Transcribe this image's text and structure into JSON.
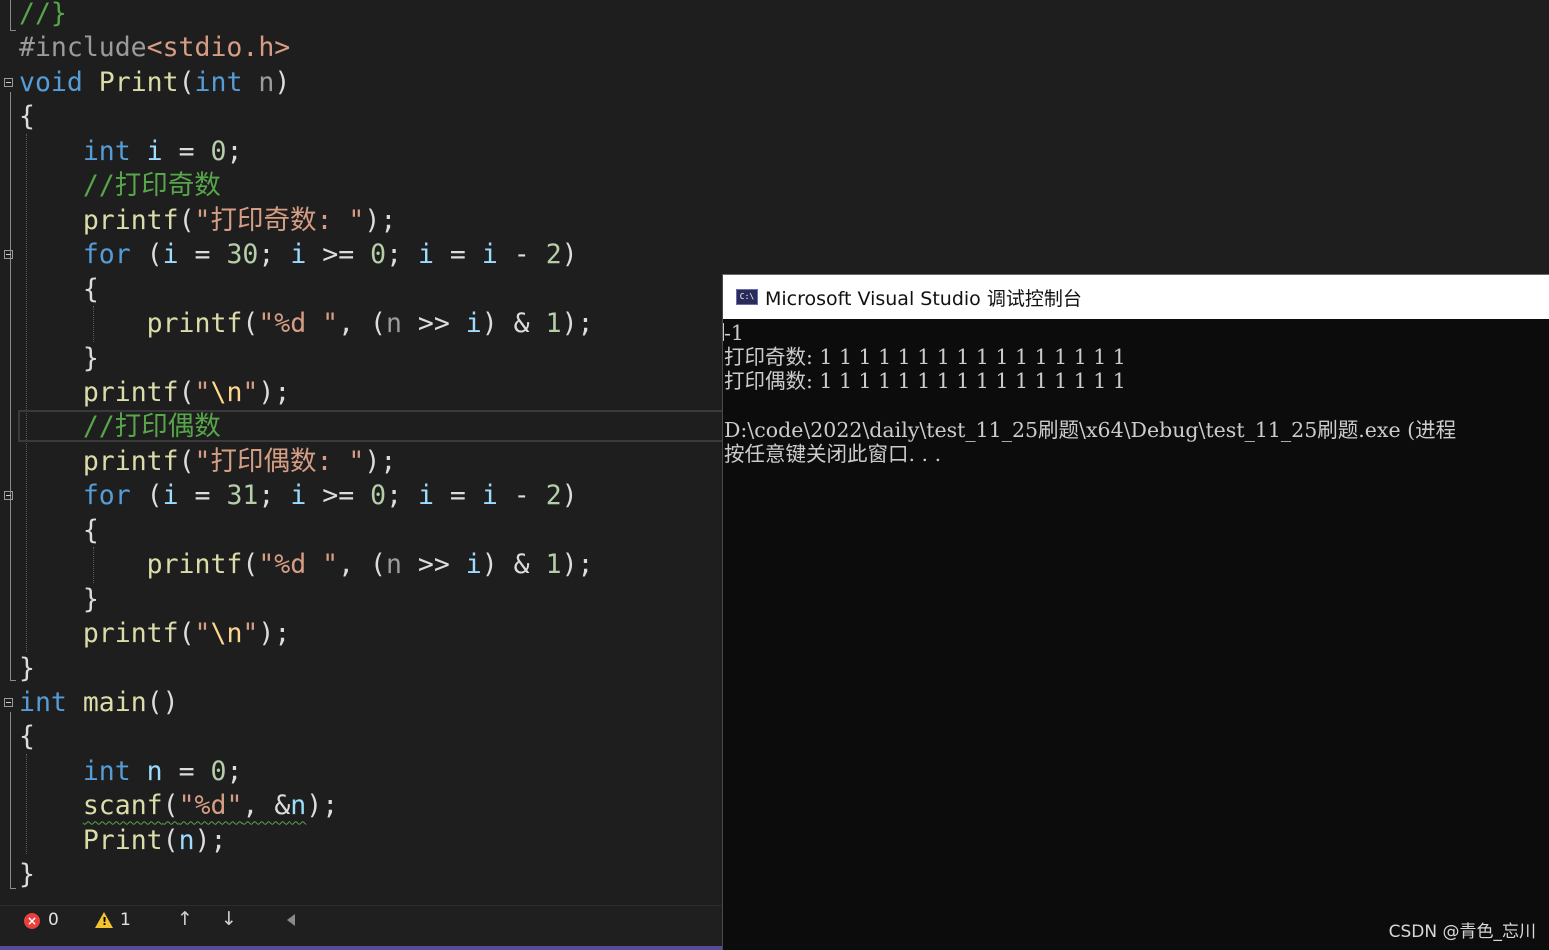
{
  "editor": {
    "lines": [
      [
        [
          "c",
          "//}"
        ]
      ],
      [
        [
          "p",
          "#include"
        ],
        [
          "s",
          "<stdio.h>"
        ]
      ],
      [
        [
          "k",
          "void"
        ],
        [
          "m",
          " "
        ],
        [
          "f",
          "Print"
        ],
        [
          "m",
          "("
        ],
        [
          "k",
          "int"
        ],
        [
          "m",
          " "
        ],
        [
          "p",
          "n"
        ],
        [
          "m",
          ")"
        ]
      ],
      [
        [
          "m",
          "{"
        ]
      ],
      [
        [
          "m",
          "    "
        ],
        [
          "k",
          "int"
        ],
        [
          "m",
          " "
        ],
        [
          "v",
          "i"
        ],
        [
          "m",
          " = "
        ],
        [
          "n",
          "0"
        ],
        [
          "m",
          ";"
        ]
      ],
      [
        [
          "m",
          "    "
        ],
        [
          "c",
          "//打印奇数"
        ]
      ],
      [
        [
          "m",
          "    "
        ],
        [
          "f",
          "printf"
        ],
        [
          "m",
          "("
        ],
        [
          "s",
          "\"打印奇数: \""
        ],
        [
          "m",
          ");"
        ]
      ],
      [
        [
          "m",
          "    "
        ],
        [
          "k",
          "for"
        ],
        [
          "m",
          " ("
        ],
        [
          "v",
          "i"
        ],
        [
          "m",
          " = "
        ],
        [
          "n",
          "30"
        ],
        [
          "m",
          "; "
        ],
        [
          "v",
          "i"
        ],
        [
          "m",
          " >= "
        ],
        [
          "n",
          "0"
        ],
        [
          "m",
          "; "
        ],
        [
          "v",
          "i"
        ],
        [
          "m",
          " = "
        ],
        [
          "v",
          "i"
        ],
        [
          "m",
          " - "
        ],
        [
          "n",
          "2"
        ],
        [
          "m",
          ")"
        ]
      ],
      [
        [
          "m",
          "    {"
        ]
      ],
      [
        [
          "m",
          "        "
        ],
        [
          "f",
          "printf"
        ],
        [
          "m",
          "("
        ],
        [
          "s",
          "\"%d \""
        ],
        [
          "m",
          ", ("
        ],
        [
          "p",
          "n"
        ],
        [
          "m",
          " >> "
        ],
        [
          "v",
          "i"
        ],
        [
          "m",
          ") & "
        ],
        [
          "n",
          "1"
        ],
        [
          "m",
          ");"
        ]
      ],
      [
        [
          "m",
          "    }"
        ]
      ],
      [
        [
          "m",
          "    "
        ],
        [
          "f",
          "printf"
        ],
        [
          "m",
          "("
        ],
        [
          "s",
          "\""
        ],
        [
          "esc",
          "\\n"
        ],
        [
          "s",
          "\""
        ],
        [
          "m",
          ");"
        ]
      ],
      [
        [
          "m",
          "    "
        ],
        [
          "c",
          "//打印偶数"
        ]
      ],
      [
        [
          "m",
          "    "
        ],
        [
          "f",
          "printf"
        ],
        [
          "m",
          "("
        ],
        [
          "s",
          "\"打印偶数: \""
        ],
        [
          "m",
          ");"
        ]
      ],
      [
        [
          "m",
          "    "
        ],
        [
          "k",
          "for"
        ],
        [
          "m",
          " ("
        ],
        [
          "v",
          "i"
        ],
        [
          "m",
          " = "
        ],
        [
          "n",
          "31"
        ],
        [
          "m",
          "; "
        ],
        [
          "v",
          "i"
        ],
        [
          "m",
          " >= "
        ],
        [
          "n",
          "0"
        ],
        [
          "m",
          "; "
        ],
        [
          "v",
          "i"
        ],
        [
          "m",
          " = "
        ],
        [
          "v",
          "i"
        ],
        [
          "m",
          " - "
        ],
        [
          "n",
          "2"
        ],
        [
          "m",
          ")"
        ]
      ],
      [
        [
          "m",
          "    {"
        ]
      ],
      [
        [
          "m",
          "        "
        ],
        [
          "f",
          "printf"
        ],
        [
          "m",
          "("
        ],
        [
          "s",
          "\"%d \""
        ],
        [
          "m",
          ", ("
        ],
        [
          "p",
          "n"
        ],
        [
          "m",
          " >> "
        ],
        [
          "v",
          "i"
        ],
        [
          "m",
          ") & "
        ],
        [
          "n",
          "1"
        ],
        [
          "m",
          ");"
        ]
      ],
      [
        [
          "m",
          "    }"
        ]
      ],
      [
        [
          "m",
          "    "
        ],
        [
          "f",
          "printf"
        ],
        [
          "m",
          "("
        ],
        [
          "s",
          "\""
        ],
        [
          "esc",
          "\\n"
        ],
        [
          "s",
          "\""
        ],
        [
          "m",
          ");"
        ]
      ],
      [
        [
          "m",
          "}"
        ]
      ],
      [
        [
          "k",
          "int"
        ],
        [
          "m",
          " "
        ],
        [
          "f",
          "main"
        ],
        [
          "m",
          "()"
        ]
      ],
      [
        [
          "m",
          "{"
        ]
      ],
      [
        [
          "m",
          "    "
        ],
        [
          "k",
          "int"
        ],
        [
          "m",
          " "
        ],
        [
          "v",
          "n"
        ],
        [
          "m",
          " = "
        ],
        [
          "n",
          "0"
        ],
        [
          "m",
          ";"
        ]
      ],
      [
        [
          "m",
          "    "
        ],
        [
          "f",
          "scanf"
        ],
        [
          "m",
          "("
        ],
        [
          "s",
          "\"%d\""
        ],
        [
          "m",
          ", &"
        ],
        [
          "v",
          "n"
        ],
        [
          "m",
          ");"
        ]
      ],
      [
        [
          "m",
          "    "
        ],
        [
          "f",
          "Print"
        ],
        [
          "m",
          "("
        ],
        [
          "v",
          "n"
        ],
        [
          "m",
          ");"
        ]
      ],
      [
        [
          "m",
          "}"
        ]
      ]
    ]
  },
  "status": {
    "errors": "0",
    "warnings": "1",
    "up_arrow": "↑",
    "down_arrow": "↓"
  },
  "console": {
    "title": "Microsoft Visual Studio 调试控制台",
    "icon_label": "C:\\",
    "output": [
      "-1",
      "打印奇数: 1 1 1 1 1 1 1 1 1 1 1 1 1 1 1 1",
      "打印偶数: 1 1 1 1 1 1 1 1 1 1 1 1 1 1 1 1",
      "",
      "D:\\code\\2022\\daily\\test_11_25刷题\\x64\\Debug\\test_11_25刷题.exe (进程",
      "按任意键关闭此窗口. . ."
    ]
  },
  "watermark": "CSDN @青色_忘川",
  "colors": {
    "keyword": "#569cd6",
    "function": "#dcdcaa",
    "string": "#d69d85",
    "comment": "#57a64a",
    "number": "#b5cea8",
    "variable": "#9cdcfe"
  }
}
